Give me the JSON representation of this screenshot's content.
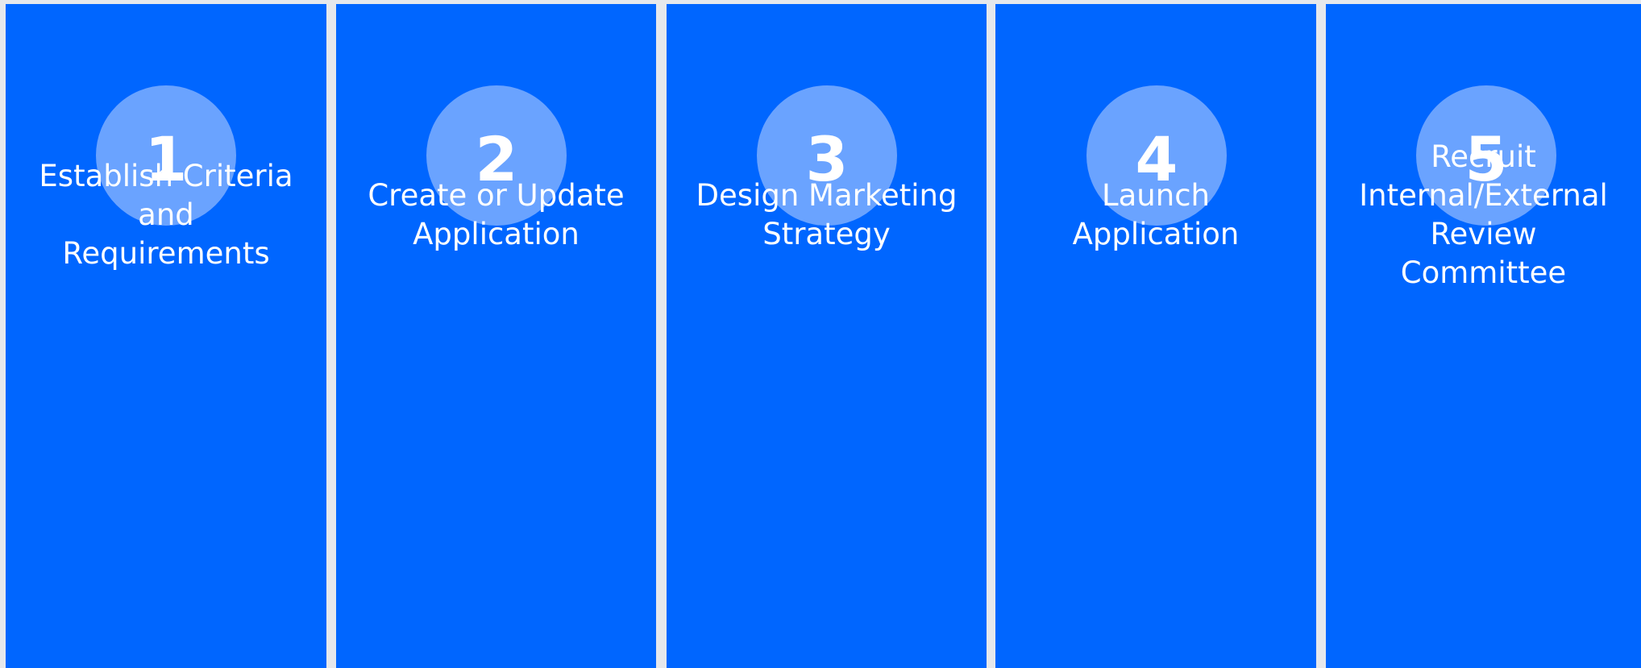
{
  "colors": {
    "background": "#e6e8ec",
    "panel": "#0066ff",
    "circle": "#6aa3ff",
    "text": "#ffffff"
  },
  "steps": [
    {
      "number": "1",
      "label_lines": [
        "Establish Criteria",
        "and",
        "Requirements"
      ]
    },
    {
      "number": "2",
      "label_lines": [
        "Create or Update",
        "Application"
      ]
    },
    {
      "number": "3",
      "label_lines": [
        "Design Marketing",
        "Strategy"
      ]
    },
    {
      "number": "4",
      "label_lines": [
        "Launch",
        "Application"
      ]
    },
    {
      "number": "5",
      "label_lines": [
        "Recruit",
        "Internal/External",
        "Review",
        "Committee"
      ]
    }
  ]
}
